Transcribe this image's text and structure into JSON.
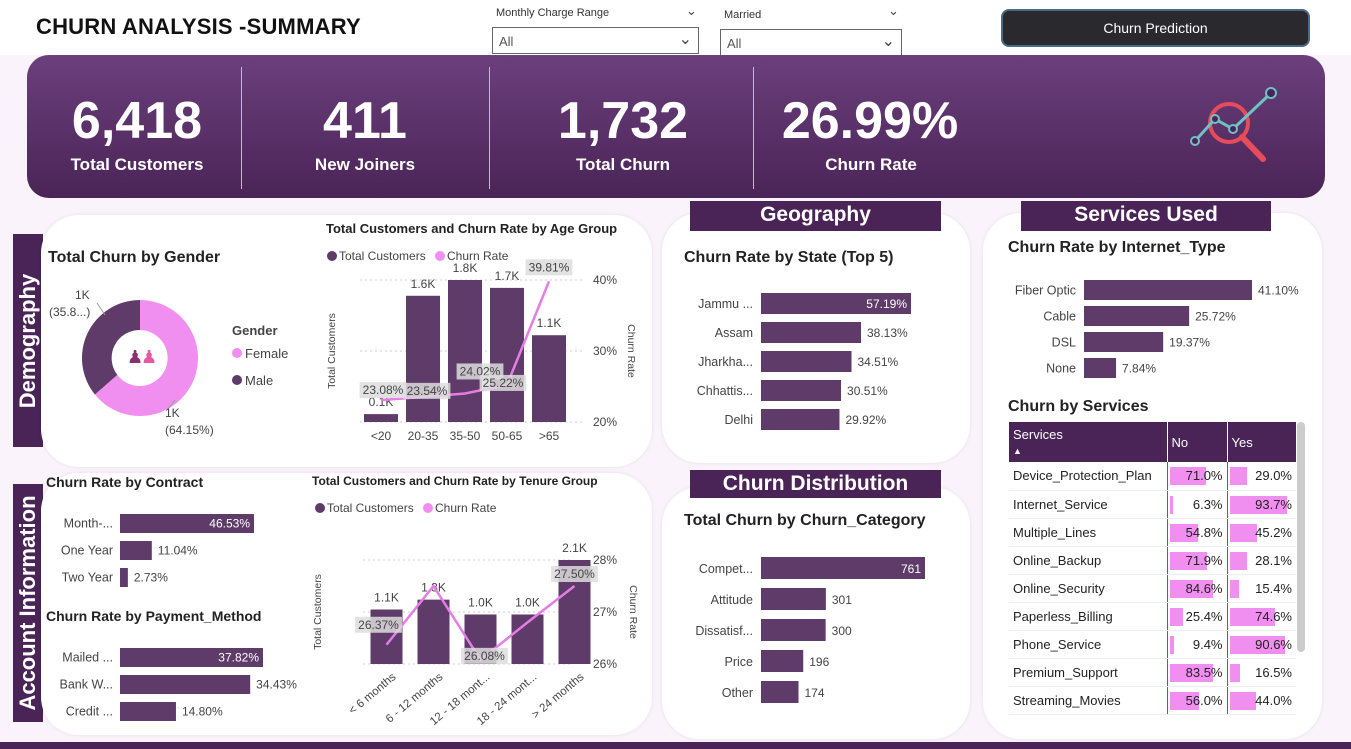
{
  "header": {
    "title": "CHURN ANALYSIS -SUMMARY",
    "predict_button": "Churn Prediction"
  },
  "slicers": [
    {
      "label": "Monthly Charge Range",
      "value": "All"
    },
    {
      "label": "Married",
      "value": "All"
    }
  ],
  "kpis": [
    {
      "value": "6,418",
      "label": "Total Customers"
    },
    {
      "value": "411",
      "label": "New Joiners"
    },
    {
      "value": "1,732",
      "label": "Total Churn"
    },
    {
      "value": "26.99%",
      "label": "Churn Rate"
    }
  ],
  "sections": {
    "demography": "Demography",
    "account": "Account Information",
    "geography": "Geography",
    "services": "Services Used",
    "distribution": "Churn Distribution"
  },
  "colors": {
    "primary": "#4a2457",
    "bar": "#5e3b68",
    "pink": "#f08ff0",
    "line": "#e67ce6"
  },
  "chart_data": [
    {
      "type": "pie",
      "title": "Total Churn by Gender",
      "legend_title": "Gender",
      "categories": [
        "Female",
        "Male"
      ],
      "values": [
        64.15,
        35.85
      ],
      "labels": [
        "1K\n(64.15%)",
        "1K\n(35.8...)"
      ]
    },
    {
      "type": "bar",
      "title": "Total Customers and Churn Rate by Age Group",
      "legend": [
        "Total Customers",
        "Churn Rate"
      ],
      "categories": [
        "<20",
        "20-35",
        "35-50",
        "50-65",
        ">65"
      ],
      "series": [
        {
          "name": "Total Customers",
          "values": [
            100,
            1600,
            1800,
            1700,
            1100
          ],
          "labels": [
            "0.1K",
            "1.6K",
            "1.8K",
            "1.7K",
            "1.1K"
          ]
        },
        {
          "name": "Churn Rate",
          "values": [
            23.08,
            23.54,
            24.02,
            25.22,
            39.81
          ],
          "labels": [
            "23.08%",
            "23.54%",
            "24.02%",
            "25.22%",
            "39.81%"
          ]
        }
      ],
      "ylabel": "Total Customers",
      "y2label": "Churn Rate",
      "y2ticks": [
        "40%",
        "30%",
        "20%"
      ],
      "y2lim": [
        20,
        40
      ]
    },
    {
      "type": "bar",
      "title": "Churn Rate by Contract",
      "categories": [
        "Month-...",
        "One Year",
        "Two Year"
      ],
      "values": [
        46.53,
        11.04,
        2.73
      ],
      "labels": [
        "46.53%",
        "11.04%",
        "2.73%"
      ]
    },
    {
      "type": "bar",
      "title": "Churn Rate by Payment_Method",
      "categories": [
        "Mailed ...",
        "Bank W...",
        "Credit ..."
      ],
      "values": [
        37.82,
        34.43,
        14.8
      ],
      "labels": [
        "37.82%",
        "34.43%",
        "14.80%"
      ]
    },
    {
      "type": "bar",
      "title": "Total Customers and Churn Rate by Tenure Group",
      "legend": [
        "Total Customers",
        "Churn Rate"
      ],
      "categories": [
        "< 6 months",
        "6 - 12 months",
        "12 - 18 mont...",
        "18 - 24 mont...",
        "> 24 months"
      ],
      "series": [
        {
          "name": "Total Customers",
          "values": [
            1100,
            1300,
            1000,
            1000,
            2100
          ],
          "labels": [
            "1.1K",
            "1.3K",
            "1.0K",
            "1.0K",
            "2.1K"
          ]
        },
        {
          "name": "Churn Rate",
          "values": [
            26.37,
            27.5,
            26.08,
            26.8,
            27.5
          ],
          "labels": [
            "26.37%",
            "",
            "26.08%",
            "",
            "27.50%"
          ]
        }
      ],
      "ylabel": "Total Customers",
      "y2label": "Churn Rate",
      "y2ticks": [
        "28%",
        "27%",
        "26%"
      ],
      "y2lim": [
        26,
        28
      ]
    },
    {
      "type": "bar",
      "title": "Churn Rate by State (Top 5)",
      "categories": [
        "Jammu ...",
        "Assam",
        "Jharkha...",
        "Chhattis...",
        "Delhi"
      ],
      "values": [
        57.19,
        38.13,
        34.51,
        30.51,
        29.92
      ],
      "labels": [
        "57.19%",
        "38.13%",
        "34.51%",
        "30.51%",
        "29.92%"
      ]
    },
    {
      "type": "bar",
      "title": "Total Churn by Churn_Category",
      "categories": [
        "Compet...",
        "Attitude",
        "Dissatisf...",
        "Price",
        "Other"
      ],
      "values": [
        761,
        301,
        300,
        196,
        174
      ],
      "labels": [
        "761",
        "301",
        "300",
        "196",
        "174"
      ]
    },
    {
      "type": "bar",
      "title": "Churn Rate by Internet_Type",
      "categories": [
        "Fiber Optic",
        "Cable",
        "DSL",
        "None"
      ],
      "values": [
        41.1,
        25.72,
        19.37,
        7.84
      ],
      "labels": [
        "41.10%",
        "25.72%",
        "19.37%",
        "7.84%"
      ]
    },
    {
      "type": "table",
      "title": "Churn by Services",
      "columns": [
        "Services",
        "No",
        "Yes"
      ],
      "rows": [
        {
          "service": "Device_Protection_Plan",
          "no": 71.0,
          "yes": 29.0,
          "no_label": "71.0%",
          "yes_label": "29.0%"
        },
        {
          "service": "Internet_Service",
          "no": 6.3,
          "yes": 93.7,
          "no_label": "6.3%",
          "yes_label": "93.7%"
        },
        {
          "service": "Multiple_Lines",
          "no": 54.8,
          "yes": 45.2,
          "no_label": "54.8%",
          "yes_label": "45.2%"
        },
        {
          "service": "Online_Backup",
          "no": 71.9,
          "yes": 28.1,
          "no_label": "71.9%",
          "yes_label": "28.1%"
        },
        {
          "service": "Online_Security",
          "no": 84.6,
          "yes": 15.4,
          "no_label": "84.6%",
          "yes_label": "15.4%"
        },
        {
          "service": "Paperless_Billing",
          "no": 25.4,
          "yes": 74.6,
          "no_label": "25.4%",
          "yes_label": "74.6%"
        },
        {
          "service": "Phone_Service",
          "no": 9.4,
          "yes": 90.6,
          "no_label": "9.4%",
          "yes_label": "90.6%"
        },
        {
          "service": "Premium_Support",
          "no": 83.5,
          "yes": 16.5,
          "no_label": "83.5%",
          "yes_label": "16.5%"
        },
        {
          "service": "Streaming_Movies",
          "no": 56.0,
          "yes": 44.0,
          "no_label": "56.0%",
          "yes_label": "44.0%"
        }
      ]
    }
  ]
}
